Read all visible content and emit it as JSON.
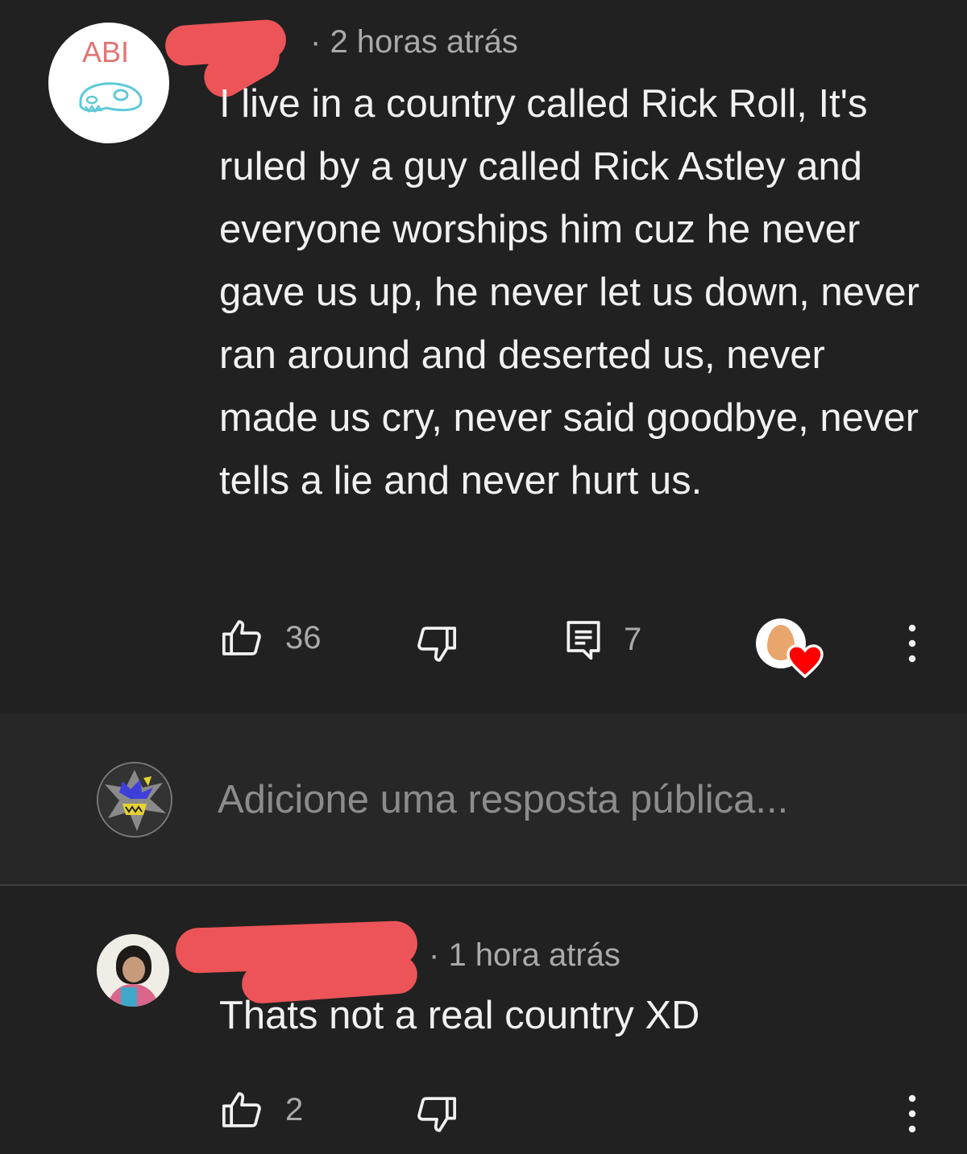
{
  "comment": {
    "avatar_text": "ABI",
    "timestamp": "2 horas atrás",
    "text": "I live in a country called Rick Roll, It's ruled by a guy called Rick Astley and everyone worships him cuz he never gave us up, he never let us down, never ran around and deserted us, never made us cry, never said goodbye, never tells a lie and never hurt us.",
    "likes": "36",
    "replies": "7",
    "icons": {
      "like": "thumbs-up-icon",
      "dislike": "thumbs-down-icon",
      "reply": "reply-icon",
      "hearted": "creator-heart-icon",
      "more": "more-vert-icon"
    }
  },
  "reply_box": {
    "placeholder": "Adicione uma resposta pública..."
  },
  "reply": {
    "timestamp": "1 hora atrás",
    "text": "Thats not a real country XD",
    "likes": "2"
  },
  "colors": {
    "background": "#212121",
    "compose_background": "#272727",
    "text": "#f1f1f1",
    "secondary_text": "#aaaaaa",
    "redaction": "#ec5457",
    "heart": "#ff0000"
  }
}
